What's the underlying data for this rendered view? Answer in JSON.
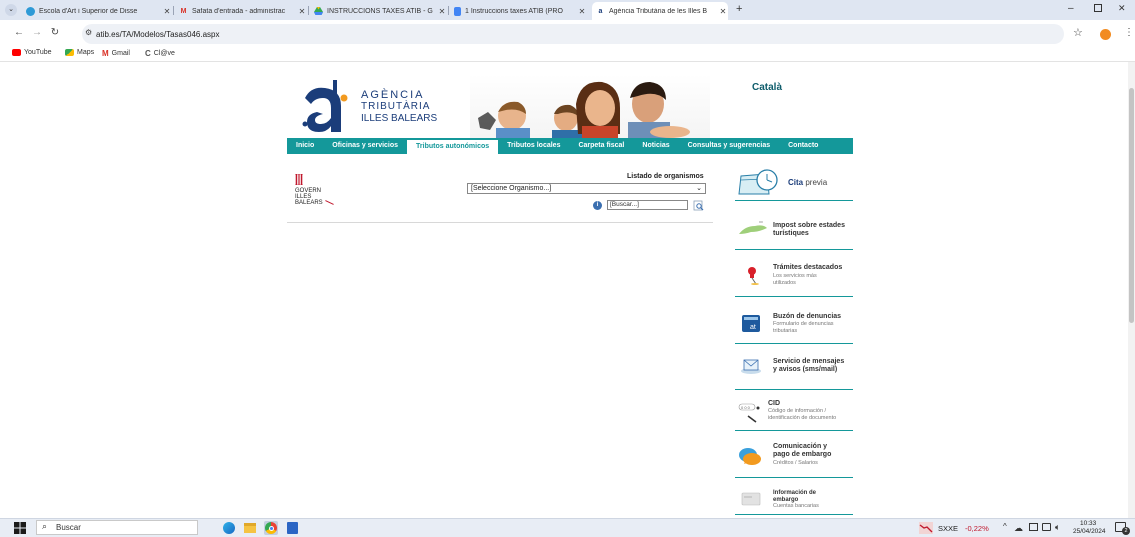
{
  "browser": {
    "tabs": [
      {
        "label": "Escola d'Art i Superior de Disse",
        "icon": "school-icon"
      },
      {
        "label": "Safata d'entrada - administrac",
        "icon": "gmail-icon"
      },
      {
        "label": "INSTRUCCIONS TAXES ATIB - G",
        "icon": "drive-icon"
      },
      {
        "label": "1 Instruccions taxes ATIB (PRO",
        "icon": "docs-icon"
      },
      {
        "label": "Agència Tributària de les Illes B",
        "icon": "atib-icon",
        "active": true
      }
    ],
    "url": "atib.es/TA/Modelos/Tasas046.aspx",
    "bookmarks": [
      "YouTube",
      "Maps",
      "Gmail",
      "Cl@ve"
    ]
  },
  "header": {
    "logo_lines": [
      "AGÈNCIA",
      "TRIBUTÀRIA",
      "ILLES BALEARS"
    ],
    "language_link": "Català"
  },
  "nav": [
    "Inicio",
    "Oficinas y servicios",
    "Tributos autonómicos",
    "Tributos locales",
    "Carpeta fiscal",
    "Noticias",
    "Consultas y sugerencias",
    "Contacto"
  ],
  "main": {
    "govern_lines": [
      "GOVERN",
      "ILLES",
      "BALEARS"
    ],
    "org_label": "Listado de organismos",
    "org_selected": "[Seleccione Organismo...]",
    "search_value": "[Buscar...]"
  },
  "sidebar": {
    "cita_a": "Cita",
    "cita_b": "previa",
    "items": [
      {
        "title": "Impost sobre estades turístiques",
        "sub": ""
      },
      {
        "title": "Trámites destacados",
        "sub": "Los servicios más utilizados"
      },
      {
        "title": "Buzón de denuncias",
        "sub": "Formulario de denuncias tributarias"
      },
      {
        "title": "Servicio de mensajes y avisos (sms/mail)",
        "sub": ""
      },
      {
        "title": "CID",
        "sub": "Código de información / identificación de documento"
      },
      {
        "title": "Comunicación y pago de embargo",
        "sub": "Créditos / Salarios"
      },
      {
        "title": "Información de embargo",
        "sub": "Cuentas bancarias"
      }
    ]
  },
  "taskbar": {
    "search": "Buscar",
    "ticker": "SXXE",
    "change": "-0,22%",
    "time": "10:33",
    "date": "25/04/2024",
    "notifications": "2"
  },
  "colors": {
    "teal": "#14989a",
    "logo_blue": "#1b3d7a",
    "logo_orange": "#f29a1f"
  }
}
